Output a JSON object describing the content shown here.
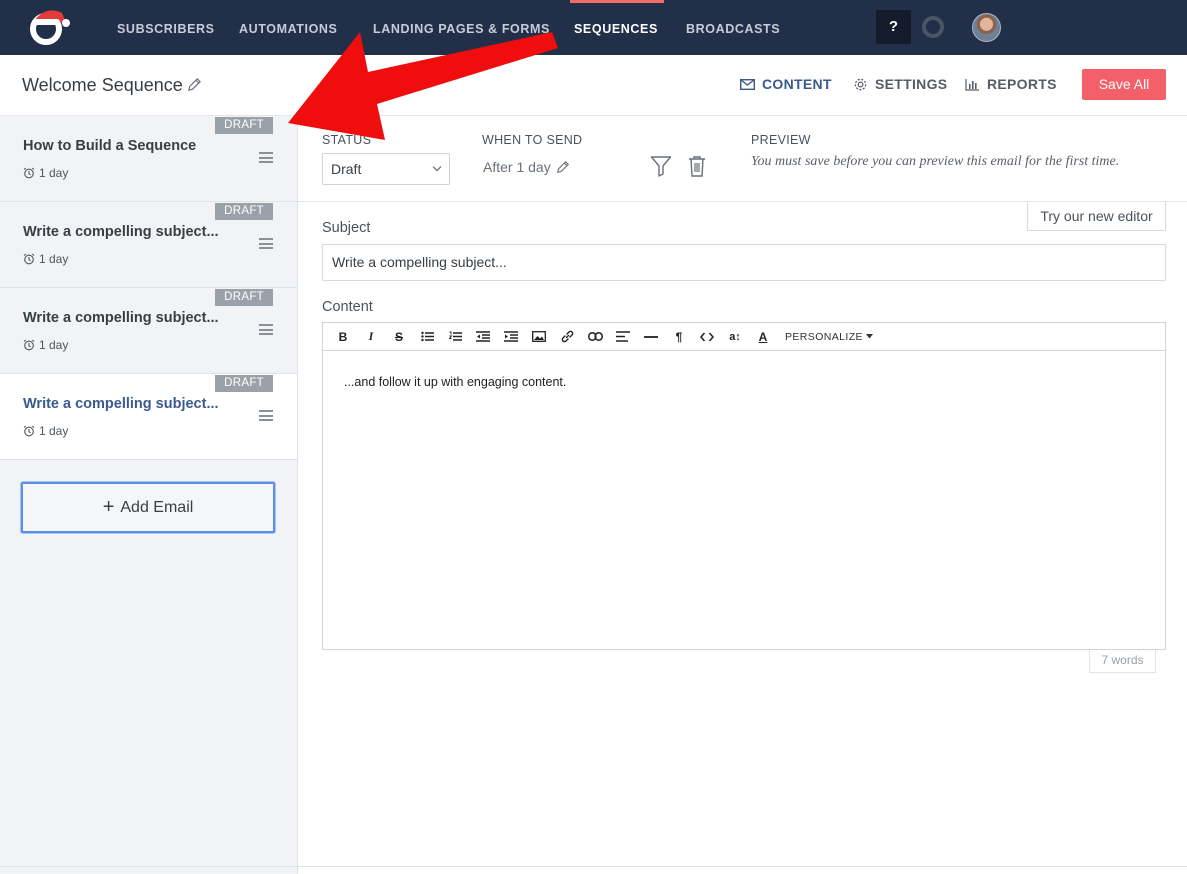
{
  "nav": {
    "items": [
      {
        "label": "SUBSCRIBERS",
        "active": false
      },
      {
        "label": "AUTOMATIONS",
        "active": false
      },
      {
        "label": "LANDING PAGES & FORMS",
        "active": false
      },
      {
        "label": "SEQUENCES",
        "active": true
      },
      {
        "label": "BROADCASTS",
        "active": false
      }
    ],
    "help_label": "?"
  },
  "header": {
    "title": "Welcome Sequence",
    "tabs": [
      {
        "label": "CONTENT",
        "icon": "envelope-icon",
        "active": true
      },
      {
        "label": "SETTINGS",
        "icon": "gear-icon",
        "active": false
      },
      {
        "label": "REPORTS",
        "icon": "bar-chart-icon",
        "active": false
      }
    ],
    "save_label": "Save All"
  },
  "sidebar": {
    "emails": [
      {
        "title": "How to Build a Sequence",
        "badge": "DRAFT",
        "delay": "1 day",
        "selected": false
      },
      {
        "title": "Write a compelling subject...",
        "badge": "DRAFT",
        "delay": "1 day",
        "selected": false
      },
      {
        "title": "Write a compelling subject...",
        "badge": "DRAFT",
        "delay": "1 day",
        "selected": false
      },
      {
        "title": "Write a compelling subject...",
        "badge": "DRAFT",
        "delay": "1 day",
        "selected": true
      }
    ],
    "add_email_label": "Add Email"
  },
  "settings": {
    "status_label": "STATUS",
    "status_value": "Draft",
    "when_label": "WHEN TO SEND",
    "when_value": "After 1 day",
    "preview_label": "PREVIEW",
    "preview_note": "You must save before you can preview this email for the first time."
  },
  "editor": {
    "try_editor_label": "Try our new editor",
    "subject_label": "Subject",
    "subject_value": "Write a compelling subject...",
    "content_label": "Content",
    "personalize_label": "PERSONALIZE",
    "body_text": "...and follow it up with engaging content.",
    "word_count": "7 words"
  },
  "colors": {
    "nav_bg": "#222f48",
    "accent": "#f26b6b",
    "save_button": "#f4606a",
    "active_tab": "#3a5a8c",
    "annotation_arrow": "#f00d0d"
  }
}
